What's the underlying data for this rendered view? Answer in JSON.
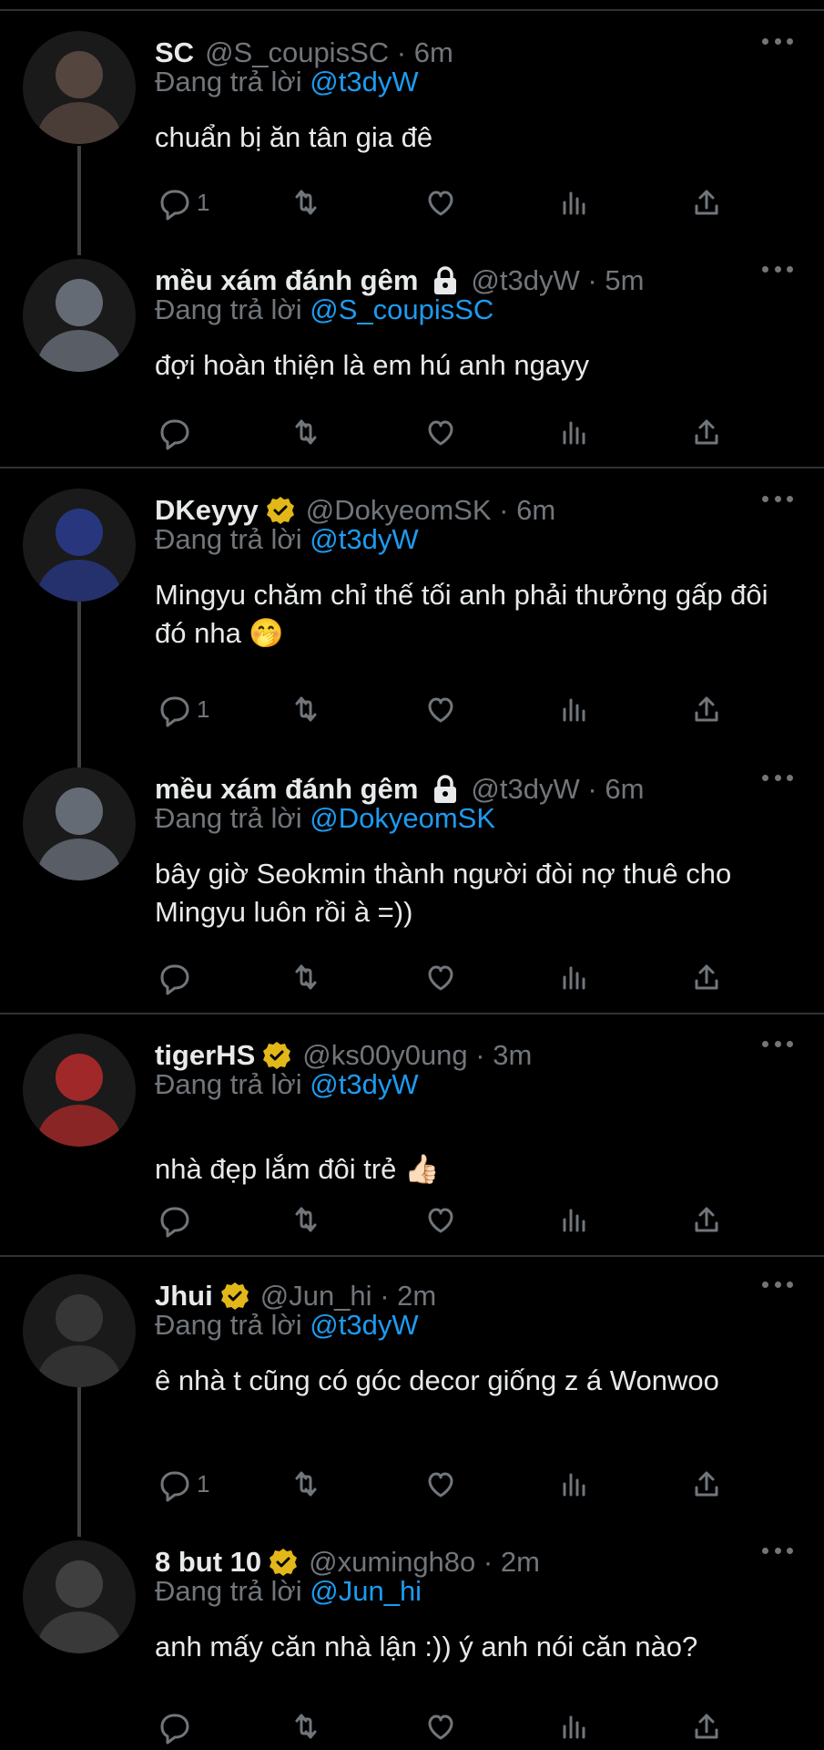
{
  "reply_prefix": "Đang trả lời",
  "tweets": [
    {
      "name": "SC",
      "verified": false,
      "locked": false,
      "handle": "@S_coupisSC",
      "sep": "·",
      "time": "6m",
      "reply_to": "@t3dyW",
      "text": "chuẩn bị ăn tân gia đê",
      "reply_count": "1",
      "avatar_color": "#5b4a42"
    },
    {
      "name": "mều xám đánh gêm",
      "verified": false,
      "locked": true,
      "handle": "@t3dyW",
      "sep": "·",
      "time": "5m",
      "reply_to": "@S_coupisSC",
      "text": "đợi hoàn thiện là em hú anh ngayy",
      "reply_count": "",
      "avatar_color": "#6e7480"
    },
    {
      "name": "DKeyyy",
      "verified": true,
      "locked": false,
      "handle": "@DokyeomSK",
      "sep": "·",
      "time": "6m",
      "reply_to": "@t3dyW",
      "text": "Mingyu chăm chỉ thế tối anh phải thưởng gấp đôi đó nha 🤭",
      "reply_count": "1",
      "avatar_color": "#2a3a8a"
    },
    {
      "name": "mều xám đánh gêm",
      "verified": false,
      "locked": true,
      "handle": "@t3dyW",
      "sep": "·",
      "time": "6m",
      "reply_to": "@DokyeomSK",
      "text": "bây giờ Seokmin thành người đòi nợ thuê cho Mingyu luôn rồi à =))",
      "reply_count": "",
      "avatar_color": "#6e7480"
    },
    {
      "name": "tigerHS",
      "verified": true,
      "locked": false,
      "handle": "@ks00y0ung",
      "sep": "·",
      "time": "3m",
      "reply_to": "@t3dyW",
      "text": "nhà đẹp lắm đôi trẻ 👍🏻",
      "reply_count": "",
      "avatar_color": "#b02a2a"
    },
    {
      "name": "Jhui",
      "verified": true,
      "locked": false,
      "handle": "@Jun_hi",
      "sep": "·",
      "time": "2m",
      "reply_to": "@t3dyW",
      "text": "ê nhà t cũng có góc decor giống z á Wonwoo",
      "reply_count": "1",
      "avatar_color": "#3a3a3a"
    },
    {
      "name": "8 but 10",
      "verified": true,
      "locked": false,
      "handle": "@xumingh8o",
      "sep": "·",
      "time": "2m",
      "reply_to": "@Jun_hi",
      "text": "anh mấy căn nhà lận :)) ý anh nói căn nào?",
      "reply_count": "",
      "avatar_color": "#444444"
    }
  ],
  "colors": {
    "background": "#000000",
    "text": "#e7e9ea",
    "muted": "#71767b",
    "link": "#1d9bf0",
    "verified": "#e2b719",
    "divider": "#2f3336"
  },
  "icons": [
    "reply-icon",
    "retweet-icon",
    "like-icon",
    "views-icon",
    "share-icon",
    "more-icon",
    "verified-badge-icon",
    "lock-icon"
  ]
}
